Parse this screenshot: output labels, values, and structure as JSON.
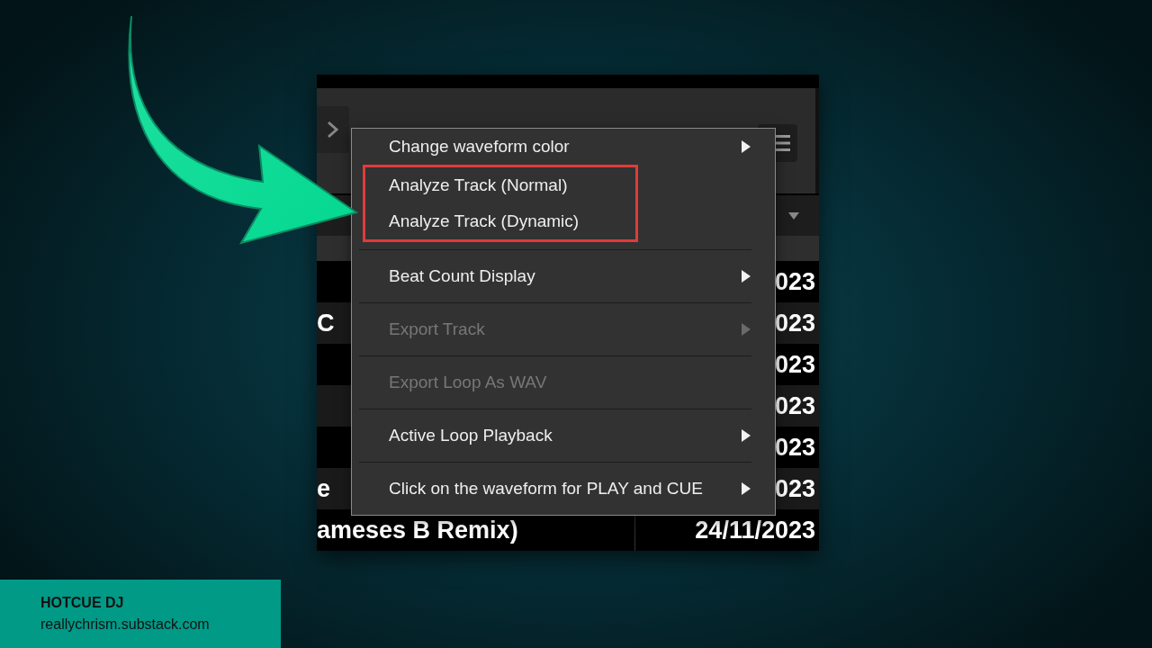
{
  "table": {
    "rows": [
      {
        "date": "023"
      },
      {
        "title": "C",
        "date": "023"
      },
      {
        "date": "023"
      },
      {
        "date": "023"
      },
      {
        "date": "023"
      },
      {
        "title": "e",
        "date": "023"
      },
      {
        "title": "ameses B Remix)",
        "date": "24/11/2023"
      }
    ]
  },
  "context_menu": {
    "items": [
      {
        "kind": "item",
        "label": "Change waveform color",
        "submenu": true,
        "disabled": false,
        "highlighted": false
      },
      {
        "kind": "item",
        "label": "Analyze Track (Normal)",
        "submenu": false,
        "disabled": false,
        "highlighted": true
      },
      {
        "kind": "item",
        "label": "Analyze Track (Dynamic)",
        "submenu": false,
        "disabled": false,
        "highlighted": true
      },
      {
        "kind": "separator"
      },
      {
        "kind": "item",
        "label": "Beat Count Display",
        "submenu": true,
        "disabled": false,
        "highlighted": false
      },
      {
        "kind": "separator"
      },
      {
        "kind": "item",
        "label": "Export Track",
        "submenu": true,
        "disabled": true,
        "highlighted": false
      },
      {
        "kind": "separator"
      },
      {
        "kind": "item",
        "label": "Export Loop As WAV",
        "submenu": false,
        "disabled": true,
        "highlighted": false
      },
      {
        "kind": "separator"
      },
      {
        "kind": "item",
        "label": "Active Loop Playback",
        "submenu": true,
        "disabled": false,
        "highlighted": false
      },
      {
        "kind": "separator"
      },
      {
        "kind": "item",
        "label": "Click on the waveform for PLAY and CUE",
        "submenu": true,
        "disabled": false,
        "highlighted": false
      }
    ]
  },
  "caption": {
    "title": "HOTCUE DJ",
    "url": "reallychrism.substack.com"
  }
}
